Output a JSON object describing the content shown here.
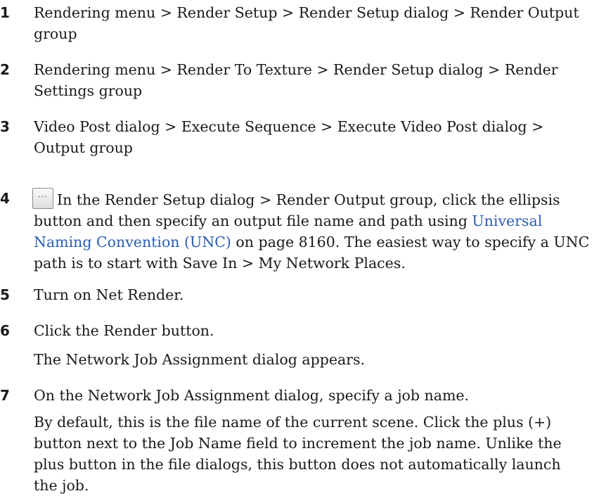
{
  "steps": [
    {
      "number": "1",
      "lines": [
        "Rendering menu > Render Setup > Render Setup dialog > Render Output",
        "group"
      ]
    },
    {
      "number": "2",
      "lines": [
        "Rendering menu > Render To Texture > Render Setup dialog > Render",
        "Settings group"
      ]
    },
    {
      "number": "3",
      "lines": [
        "Video Post dialog > Execute Sequence > Execute Video Post dialog >",
        "Output group"
      ]
    },
    {
      "number": "4",
      "icon": "ellipsis-button-icon",
      "icon_glyph": "...",
      "line1": "In the Render Setup dialog > Render Output group, click the ellipsis",
      "line2_pre": "button and then specify an output file name and path using ",
      "link_part1": "Universal",
      "link_part2": "Naming Convention (UNC)",
      "line3_post": " on page 8160. The easiest way to specify a UNC",
      "line4": "path is to start with Save In > My Network Places."
    },
    {
      "number": "5",
      "text": "Turn on Net Render."
    },
    {
      "number": "6",
      "text": "Click the Render button.",
      "note": "The Network Job Assignment dialog appears."
    },
    {
      "number": "7",
      "text": "On the Network Job Assignment dialog, specify a job name.",
      "note_lines": [
        "By default, this is the file name of the current scene. Click the plus (+)",
        "button next to the Job Name field to increment the job name. Unlike the",
        "plus button in the file dialogs, this button does not automatically launch",
        "the job."
      ]
    }
  ]
}
